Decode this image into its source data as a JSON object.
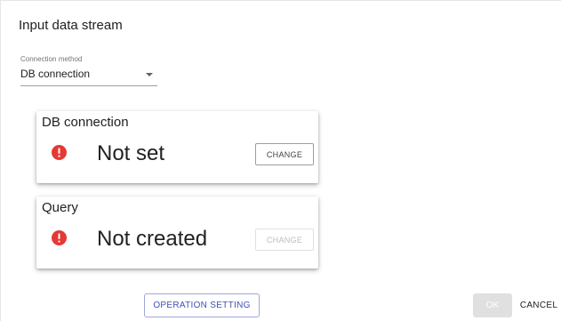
{
  "dialog": {
    "title": "Input data stream"
  },
  "connection_method": {
    "label": "Connection method",
    "value": "DB connection"
  },
  "cards": {
    "db_connection": {
      "title": "DB connection",
      "status": "Not set",
      "button_label": "CHANGE",
      "button_enabled": true,
      "icon": "error-icon"
    },
    "query": {
      "title": "Query",
      "status": "Not created",
      "button_label": "CHANGE",
      "button_enabled": false,
      "icon": "error-icon"
    }
  },
  "footer": {
    "operation_setting_label": "OPERATION SETTING",
    "ok_label": "OK",
    "ok_enabled": false,
    "cancel_label": "CANCEL"
  },
  "colors": {
    "error": "#e53935",
    "primary": "#3f51b5",
    "disabled": "#e0e0e0"
  }
}
